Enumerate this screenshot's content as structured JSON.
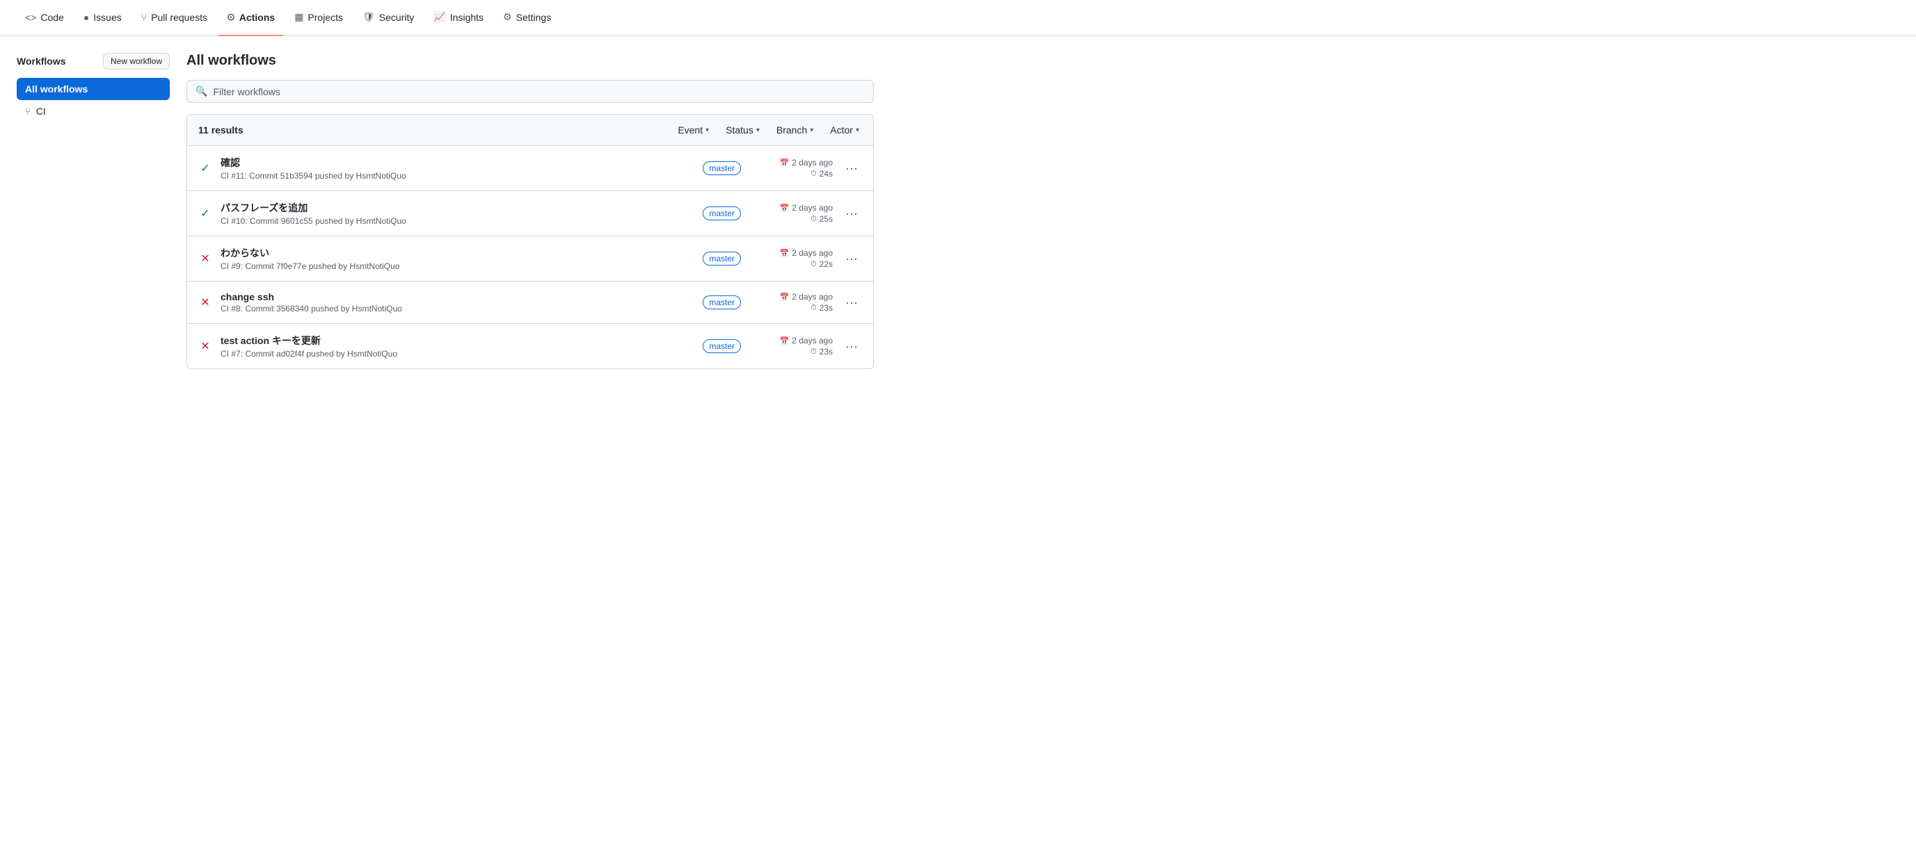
{
  "nav": {
    "items": [
      {
        "id": "code",
        "label": "Code",
        "icon": "<>",
        "active": false
      },
      {
        "id": "issues",
        "label": "Issues",
        "icon": "ⓘ",
        "active": false
      },
      {
        "id": "pull-requests",
        "label": "Pull requests",
        "icon": "⑂",
        "active": false
      },
      {
        "id": "actions",
        "label": "Actions",
        "icon": "⊙",
        "active": true
      },
      {
        "id": "projects",
        "label": "Projects",
        "icon": "▦",
        "active": false
      },
      {
        "id": "security",
        "label": "Security",
        "icon": "🛡",
        "active": false
      },
      {
        "id": "insights",
        "label": "Insights",
        "icon": "📈",
        "active": false
      },
      {
        "id": "settings",
        "label": "Settings",
        "icon": "⚙",
        "active": false
      }
    ]
  },
  "sidebar": {
    "title": "Workflows",
    "new_workflow_label": "New workflow",
    "items": [
      {
        "id": "all-workflows",
        "label": "All workflows",
        "active": true
      },
      {
        "id": "ci",
        "label": "CI",
        "active": false
      }
    ]
  },
  "main": {
    "title": "All workflows",
    "filter_placeholder": "Filter workflows",
    "results_count": "11 results",
    "filters": [
      {
        "id": "event",
        "label": "Event"
      },
      {
        "id": "status",
        "label": "Status"
      },
      {
        "id": "branch",
        "label": "Branch"
      },
      {
        "id": "actor",
        "label": "Actor"
      }
    ],
    "rows": [
      {
        "id": 1,
        "status": "success",
        "name": "確認",
        "sub": "CI #11: Commit 51b3594 pushed by HsmtNotiQuo",
        "branch": "master",
        "time": "2 days ago",
        "duration": "24s"
      },
      {
        "id": 2,
        "status": "success",
        "name": "パスフレーズを追加",
        "sub": "CI #10: Commit 9601c55 pushed by HsmtNotiQuo",
        "branch": "master",
        "time": "2 days ago",
        "duration": "25s"
      },
      {
        "id": 3,
        "status": "failure",
        "name": "わからない",
        "sub": "CI #9: Commit 7f0e77e pushed by HsmtNotiQuo",
        "branch": "master",
        "time": "2 days ago",
        "duration": "22s"
      },
      {
        "id": 4,
        "status": "failure",
        "name": "change ssh",
        "sub": "CI #8: Commit 3568340 pushed by HsmtNotiQuo",
        "branch": "master",
        "time": "2 days ago",
        "duration": "23s"
      },
      {
        "id": 5,
        "status": "failure",
        "name": "test action キーを更新",
        "sub": "CI #7: Commit ad02f4f pushed by HsmtNotiQuo",
        "branch": "master",
        "time": "2 days ago",
        "duration": "23s"
      }
    ]
  }
}
